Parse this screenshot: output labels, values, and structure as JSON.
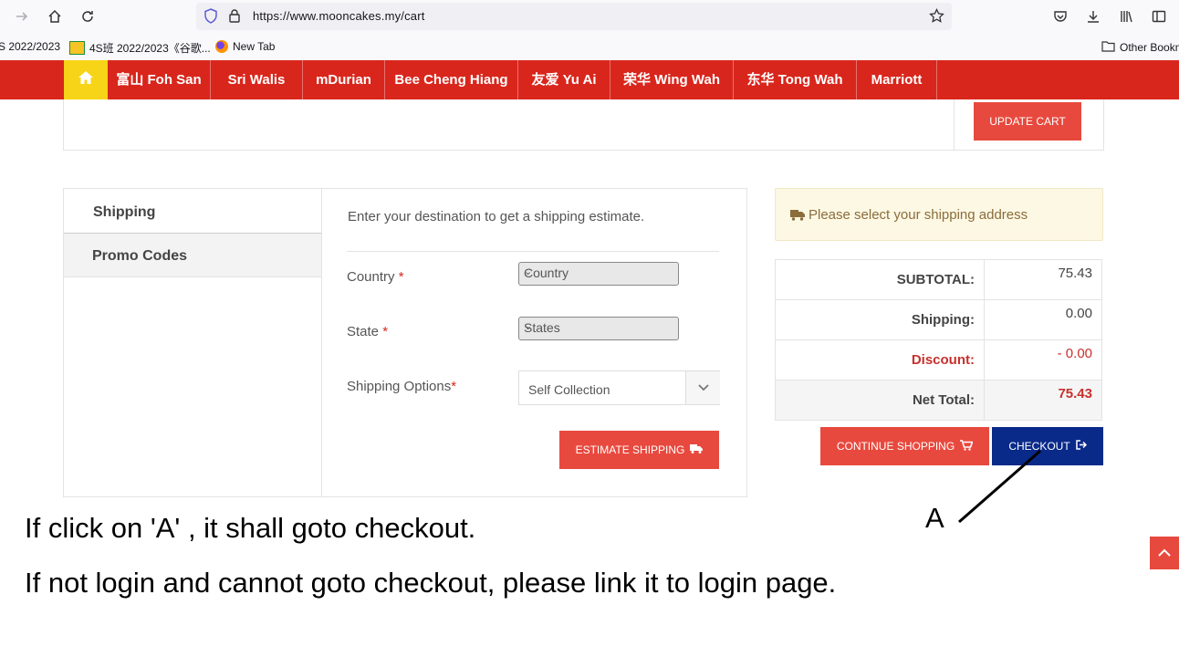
{
  "browser": {
    "url": "https://www.mooncakes.my/cart",
    "bookmarks": [
      "S 2022/2023",
      "4S班 2022/2023《谷歌...",
      "New Tab"
    ],
    "other_bookmarks": "Other Bookm"
  },
  "nav": {
    "items": [
      "富山 Foh San",
      "Sri Walis",
      "mDurian",
      "Bee Cheng Hiang",
      "友爱 Yu Ai",
      "荣华 Wing Wah",
      "东华 Tong Wah",
      "Marriott"
    ]
  },
  "cart": {
    "update_label": "UPDATE CART"
  },
  "shipping": {
    "tabs": [
      "Shipping",
      "Promo Codes"
    ],
    "intro": "Enter your destination to get a shipping estimate.",
    "country_label": "Country",
    "country_value": "Country",
    "state_label": "State",
    "state_value": "States",
    "options_label": "Shipping Options",
    "options_value": "Self Collection",
    "required_mark": "*",
    "estimate_label": "ESTIMATE SHIPPING"
  },
  "summary": {
    "alert": "Please select your shipping address",
    "rows": [
      {
        "label": "SUBTOTAL:",
        "value": "75.43"
      },
      {
        "label": "Shipping:",
        "value": "0.00"
      },
      {
        "label": "Discount:",
        "value": "- 0.00"
      },
      {
        "label": "Net Total:",
        "value": "75.43"
      }
    ],
    "continue_label": "CONTINUE SHOPPING",
    "checkout_label": "CHECKOUT"
  },
  "annotation": {
    "marker": "A",
    "line1": "If click on 'A' , it shall goto checkout.",
    "line2": "If not login and cannot goto checkout, please link it to login page."
  },
  "colors": {
    "nav_red": "#d9261c",
    "home_yellow": "#f7d417",
    "button_red": "#e8493e",
    "checkout_blue": "#0a2a8a"
  }
}
